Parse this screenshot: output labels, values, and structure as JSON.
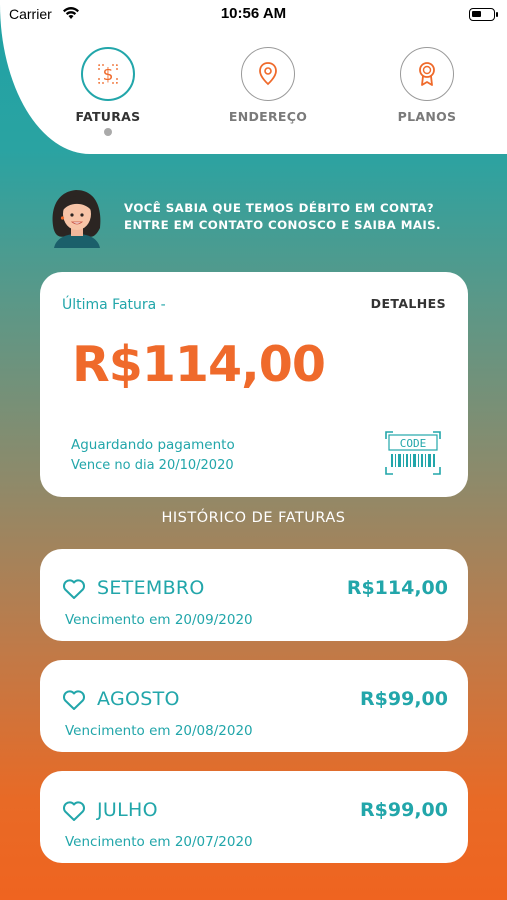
{
  "status_bar": {
    "carrier": "Carrier",
    "time": "10:56 AM"
  },
  "nav": {
    "tabs": [
      {
        "label": "FATURAS",
        "icon": "dollar-icon",
        "active": true
      },
      {
        "label": "ENDEREÇO",
        "icon": "location-pin-icon",
        "active": false
      },
      {
        "label": "PLANOS",
        "icon": "award-ribbon-icon",
        "active": false
      }
    ]
  },
  "banner": {
    "line1": "VOCÊ SABIA QUE TEMOS DÉBITO EM CONTA?",
    "line2": "ENTRE EM CONTATO CONOSCO E SAIBA MAIS."
  },
  "latest_invoice": {
    "title": "Última Fatura -",
    "details_label": "DETALHES",
    "amount": "R$114,00",
    "status": "Aguardando pagamento",
    "due": "Vence no dia 20/10/2020",
    "barcode_text": "CODE"
  },
  "history": {
    "title": "HISTÓRICO DE FATURAS",
    "items": [
      {
        "month": "SETEMBRO",
        "price": "R$114,00",
        "due": "Vencimento em 20/09/2020"
      },
      {
        "month": "AGOSTO",
        "price": "R$99,00",
        "due": "Vencimento em 20/08/2020"
      },
      {
        "month": "JULHO",
        "price": "R$99,00",
        "due": "Vencimento em 20/07/2020"
      }
    ]
  },
  "colors": {
    "accent_teal": "#22a6aa",
    "accent_orange": "#ef6a2b",
    "gradient_top": "#1fa2a5",
    "gradient_bottom": "#ef6420"
  }
}
